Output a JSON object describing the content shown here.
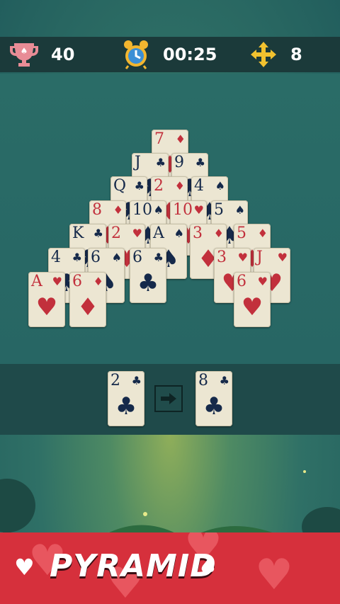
{
  "hud": {
    "score": "40",
    "time": "00:25",
    "moves": "8",
    "score_icon": "trophy-icon",
    "time_icon": "alarm-clock-icon",
    "moves_icon": "move-arrows-icon"
  },
  "colors": {
    "red_suit": "#c2303c",
    "black_suit": "#15294a",
    "card_face": "#ece6d2",
    "banner": "#d6303c"
  },
  "pyramid": [
    {
      "rank": "7",
      "suit": "♦",
      "color": "red"
    },
    {
      "rank": "J",
      "suit": "♣",
      "color": "blk"
    },
    {
      "rank": "9",
      "suit": "♣",
      "color": "blk"
    },
    {
      "rank": "Q",
      "suit": "♣",
      "color": "blk"
    },
    {
      "rank": "2",
      "suit": "♦",
      "color": "red"
    },
    {
      "rank": "4",
      "suit": "♠",
      "color": "blk"
    },
    {
      "rank": "8",
      "suit": "♦",
      "color": "red"
    },
    {
      "rank": "10",
      "suit": "♠",
      "color": "blk"
    },
    {
      "rank": "10",
      "suit": "♥",
      "color": "red"
    },
    {
      "rank": "5",
      "suit": "♠",
      "color": "blk"
    },
    {
      "rank": "K",
      "suit": "♣",
      "color": "blk"
    },
    {
      "rank": "2",
      "suit": "♥",
      "color": "red"
    },
    {
      "rank": "A",
      "suit": "♠",
      "color": "blk"
    },
    {
      "rank": "3",
      "suit": "♦",
      "color": "red"
    },
    {
      "rank": "5",
      "suit": "♦",
      "color": "red"
    },
    {
      "rank": "4",
      "suit": "♣",
      "color": "blk"
    },
    {
      "rank": "6",
      "suit": "♠",
      "color": "blk"
    },
    {
      "rank": "6",
      "suit": "♣",
      "color": "blk"
    },
    {
      "rank": "3",
      "suit": "♥",
      "color": "red"
    },
    {
      "rank": "J",
      "suit": "♥",
      "color": "red"
    },
    {
      "rank": "A",
      "suit": "♥",
      "color": "red"
    },
    {
      "rank": "6",
      "suit": "♦",
      "color": "red"
    },
    {
      "rank": "6",
      "suit": "♥",
      "color": "red"
    }
  ],
  "stock": {
    "rank": "2",
    "suit": "♣",
    "color": "blk"
  },
  "waste": {
    "rank": "8",
    "suit": "♣",
    "color": "blk"
  },
  "banner": {
    "title": "PYRAMID",
    "left_suit": "♥",
    "right_suit": "♠"
  }
}
